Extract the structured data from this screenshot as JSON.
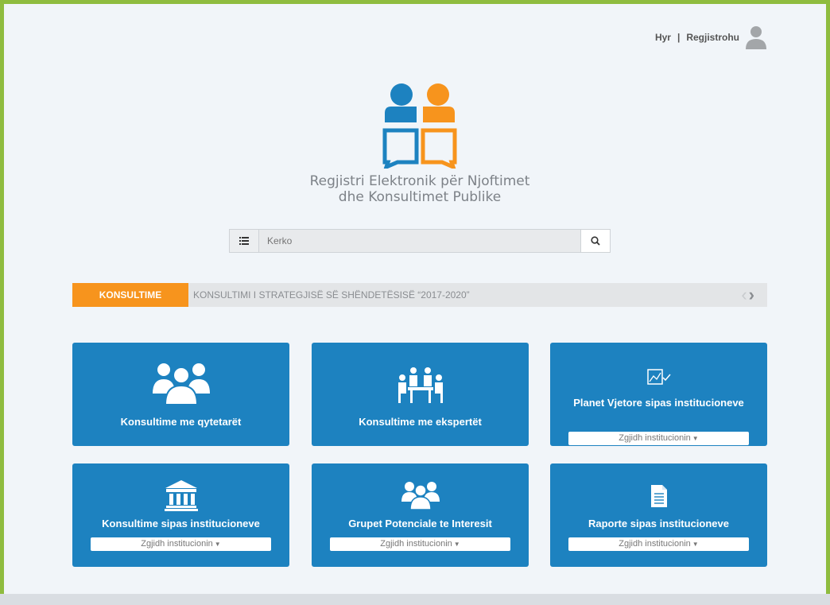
{
  "header": {
    "login_label": "Hyr",
    "separator": "|",
    "register_label": "Regjistrohu"
  },
  "logo": {
    "title_line1": "Regjistri Elektronik për Njoftimet",
    "title_line2": "dhe Konsultimet Publike",
    "colors": {
      "blue": "#1d82c0",
      "orange": "#f7941d"
    }
  },
  "search": {
    "placeholder": "Kerko",
    "value": ""
  },
  "ticker": {
    "label": "KONSULTIME",
    "text": "KONSULTIMI I STRATEGJISË SË SHËNDETËSISË “2017-2020”"
  },
  "cards": [
    {
      "title": "Konsultime me qytetarët",
      "icon": "citizens-group-icon"
    },
    {
      "title": "Konsultime me ekspertët",
      "icon": "experts-meeting-icon"
    },
    {
      "title": "Planet Vjetore sipas institucioneve",
      "icon": "annual-plan-chart-icon",
      "select": "Zgjidh institucionin"
    },
    {
      "title": "Konsultime sipas institucioneve",
      "icon": "institution-building-icon",
      "select": "Zgjidh institucionin"
    },
    {
      "title": "Grupet Potenciale te Interesit",
      "icon": "interest-groups-icon",
      "select": "Zgjidh institucionin"
    },
    {
      "title": "Raporte sipas institucioneve",
      "icon": "report-document-icon",
      "select": "Zgjidh institucionin"
    }
  ],
  "colors": {
    "frame": "#8fbc3f",
    "card": "#1d82c0",
    "accent": "#f7941d",
    "background": "#f1f5f9"
  }
}
